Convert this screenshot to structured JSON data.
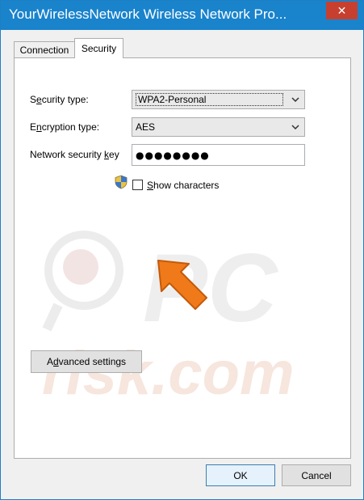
{
  "window": {
    "title": "YourWirelessNetwork Wireless Network Pro...",
    "close_glyph": "✕"
  },
  "tabs": [
    {
      "label": "Connection",
      "active": false
    },
    {
      "label": "Security",
      "active": true
    }
  ],
  "form": {
    "security_type": {
      "label_pre": "S",
      "label_ul": "e",
      "label_post": "curity type:",
      "value": "WPA2-Personal"
    },
    "encryption_type": {
      "label_pre": "E",
      "label_ul": "n",
      "label_post": "cryption type:",
      "value": "AES"
    },
    "network_key": {
      "label_pre": "Network security ",
      "label_ul": "k",
      "label_post": "ey",
      "value": "●●●●●●●●"
    },
    "show_characters": {
      "label_ul": "S",
      "label_post": "how characters",
      "checked": false
    }
  },
  "advanced_button": {
    "label_pre": "A",
    "label_ul": "d",
    "label_post": "vanced settings"
  },
  "footer": {
    "ok": "OK",
    "cancel": "Cancel"
  },
  "watermark": {
    "text": "PC risk.com"
  },
  "colors": {
    "titlebar": "#1983cc",
    "close": "#c7402f",
    "arrow": "#f07a1a",
    "watermark": "#e8e8e8"
  }
}
